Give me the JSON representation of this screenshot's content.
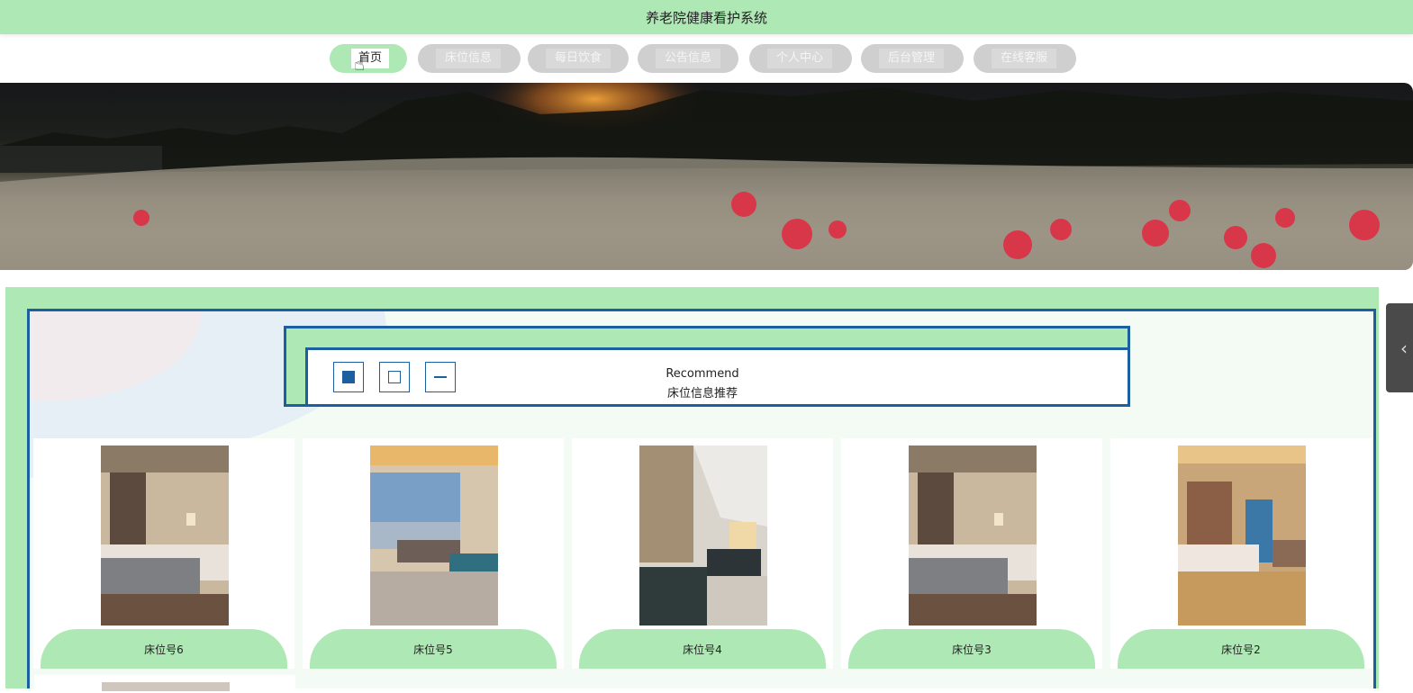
{
  "app": {
    "title": "养老院健康看护系统"
  },
  "nav": {
    "items": [
      {
        "label": "首页",
        "active": true
      },
      {
        "label": "床位信息",
        "active": false
      },
      {
        "label": "每日饮食",
        "active": false
      },
      {
        "label": "公告信息",
        "active": false
      },
      {
        "label": "个人中心",
        "active": false
      },
      {
        "label": "后台管理",
        "active": false
      },
      {
        "label": "在线客服",
        "active": false
      }
    ]
  },
  "section": {
    "title_en": "Recommend",
    "title_cn": "床位信息推荐"
  },
  "cards": [
    {
      "label": "床位号6"
    },
    {
      "label": "床位号5"
    },
    {
      "label": "床位号4"
    },
    {
      "label": "床位号3"
    },
    {
      "label": "床位号2"
    }
  ],
  "colors": {
    "accent_green": "#aee8b4",
    "border_blue": "#1b5fa0",
    "nav_inactive": "#cfcfcf"
  },
  "icons": {
    "side_tab": "chevron-left-icon",
    "cursor": "hand-pointer-icon"
  }
}
